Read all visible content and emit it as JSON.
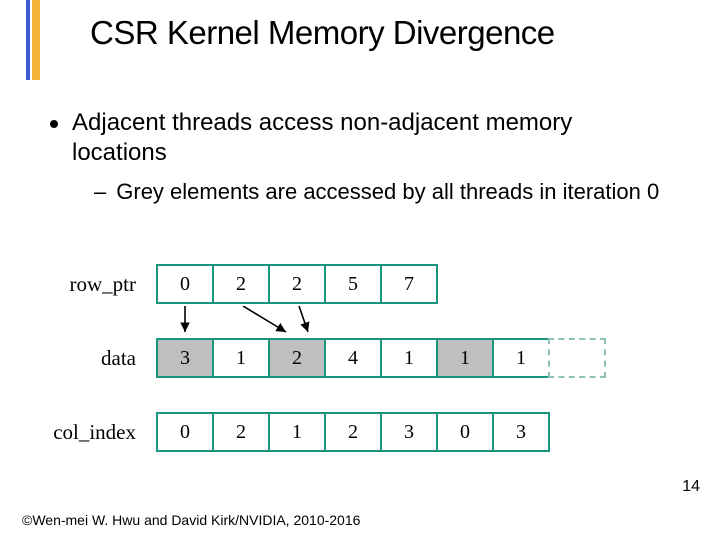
{
  "title": "CSR Kernel Memory Divergence",
  "bullets": {
    "b1": "Adjacent threads access non-adjacent memory locations",
    "b2": "Grey elements are accessed by all threads in iteration 0"
  },
  "rows": {
    "row_ptr": {
      "label": "row_ptr",
      "c0": "0",
      "c1": "2",
      "c2": "2",
      "c3": "5",
      "c4": "7"
    },
    "data": {
      "label": "data",
      "c0": "3",
      "c1": "1",
      "c2": "2",
      "c3": "4",
      "c4": "1",
      "c5": "1",
      "c6": "1"
    },
    "col_index": {
      "label": "col_index",
      "c0": "0",
      "c1": "2",
      "c2": "1",
      "c3": "2",
      "c4": "3",
      "c5": "0",
      "c6": "3"
    }
  },
  "page_number": "14",
  "copyright": "©Wen-mei W. Hwu and David Kirk/NVIDIA, 2010-2016"
}
